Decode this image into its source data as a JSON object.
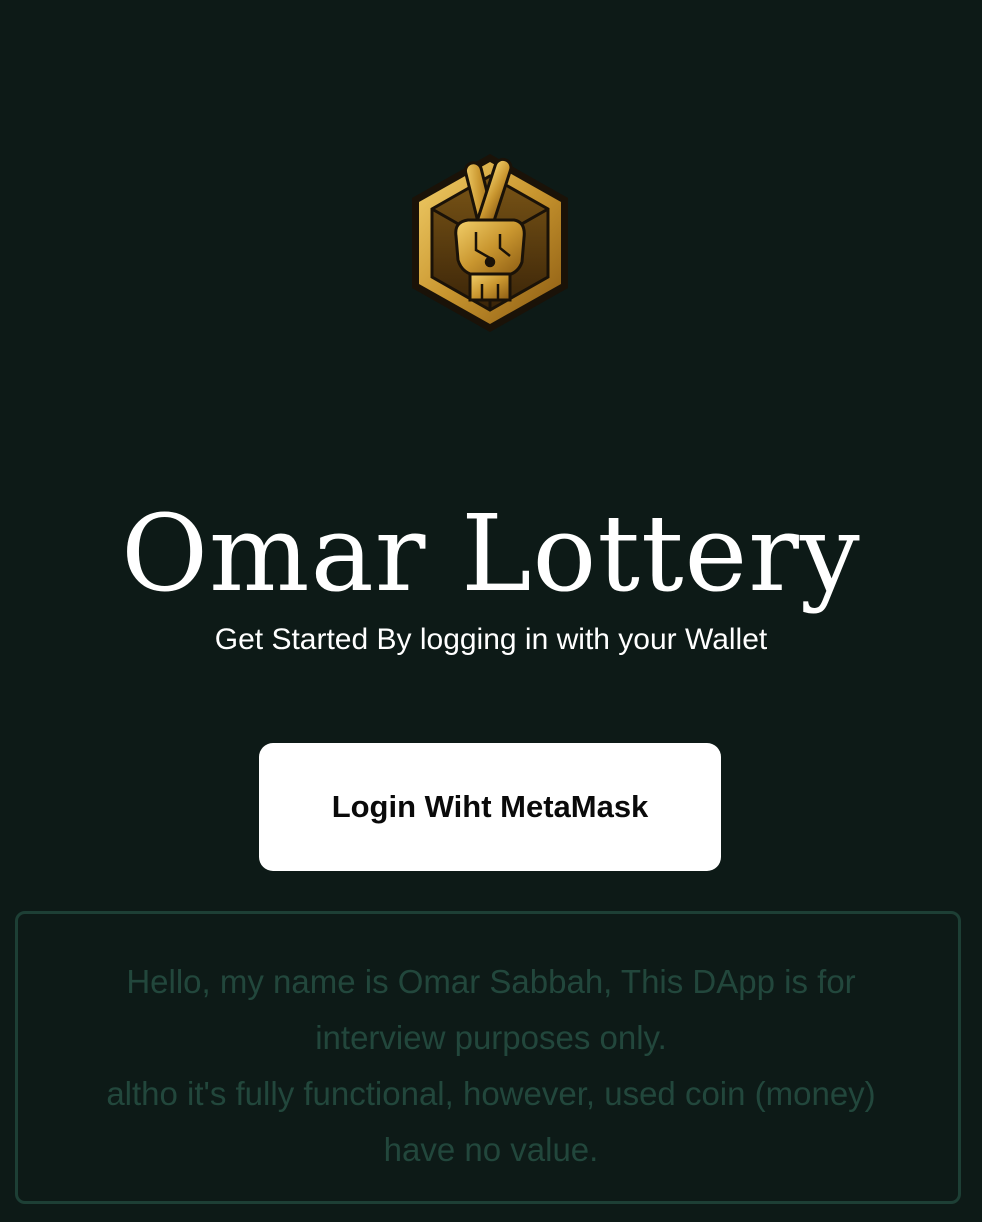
{
  "logo": {
    "icon": "crossed-fingers-hexagon-logo",
    "colors": {
      "gold": "#c9a044",
      "dark_gold": "#6b4a12",
      "outline": "#1a1208"
    }
  },
  "header": {
    "title": "Omar Lottery",
    "subtitle": "Get Started By logging in with your Wallet"
  },
  "login": {
    "button_label": "Login Wiht MetaMask"
  },
  "notice": {
    "line1": "Hello, my name is Omar Sabbah, This DApp is for interview purposes only.",
    "line2": "altho it's fully functional, however, used coin (money) have no value."
  },
  "theme": {
    "background": "#0d1a17",
    "notice_border": "#1d3f35",
    "notice_text": "#22473c"
  }
}
